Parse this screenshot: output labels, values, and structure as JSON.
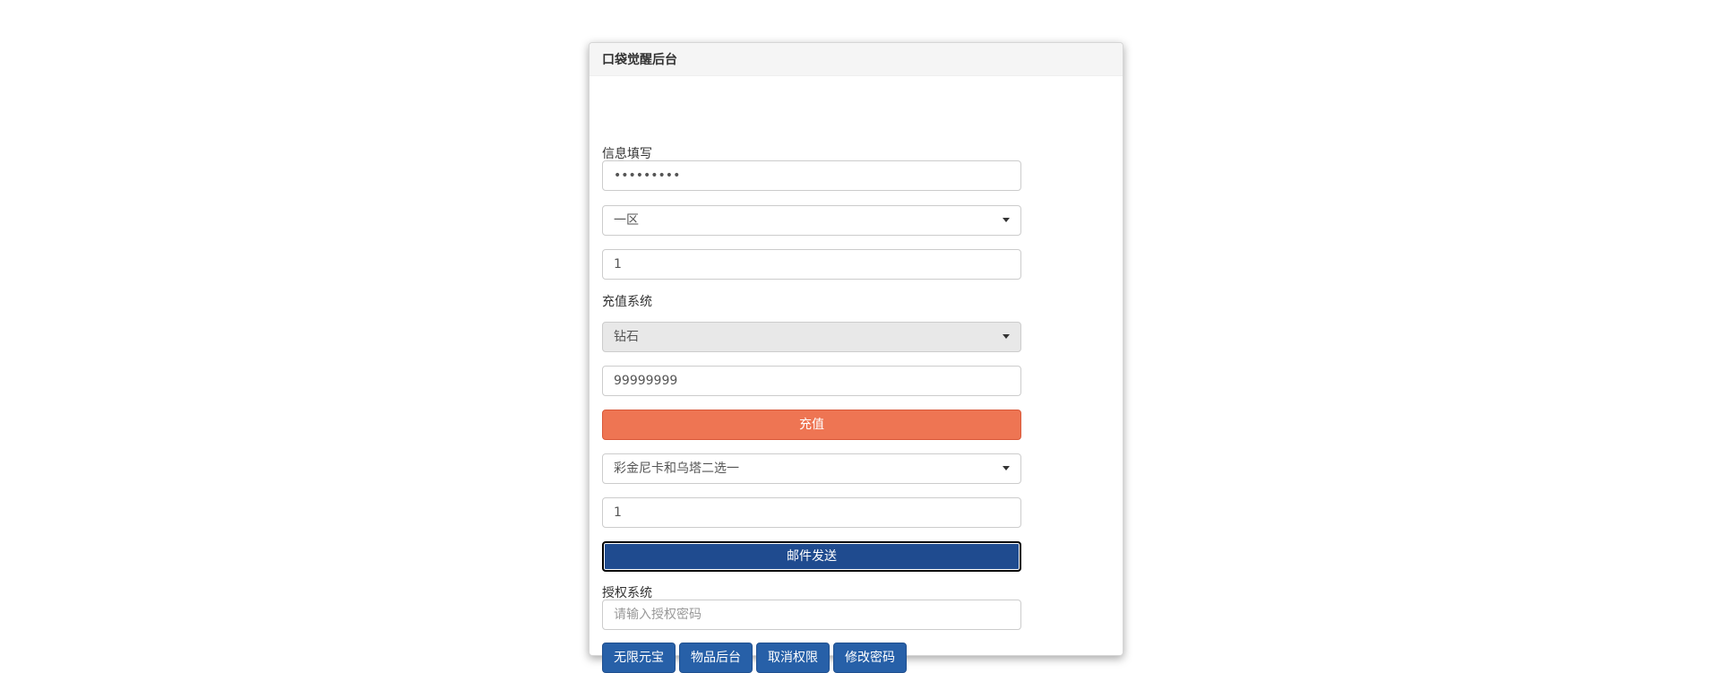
{
  "panel": {
    "title": "口袋觉醒后台"
  },
  "info": {
    "section_label": "信息填写",
    "password_value": "•••••••••",
    "server_select": "一区",
    "role_field": "1"
  },
  "recharge": {
    "section_label": "充值系统",
    "currency_select": "钻石",
    "amount_field": "99999999",
    "button_label": "充值"
  },
  "mail": {
    "item_select": "彩金尼卡和乌塔二选一",
    "quantity_field": "1",
    "button_label": "邮件发送"
  },
  "auth": {
    "section_label": "授权系统",
    "password_placeholder": "请输入授权密码",
    "buttons": [
      "无限元宝",
      "物品后台",
      "取消权限",
      "修改密码"
    ]
  },
  "colors": {
    "recharge_button": "#ee7553",
    "mail_button": "#1f4b8f",
    "auth_buttons": "#2760a8"
  }
}
